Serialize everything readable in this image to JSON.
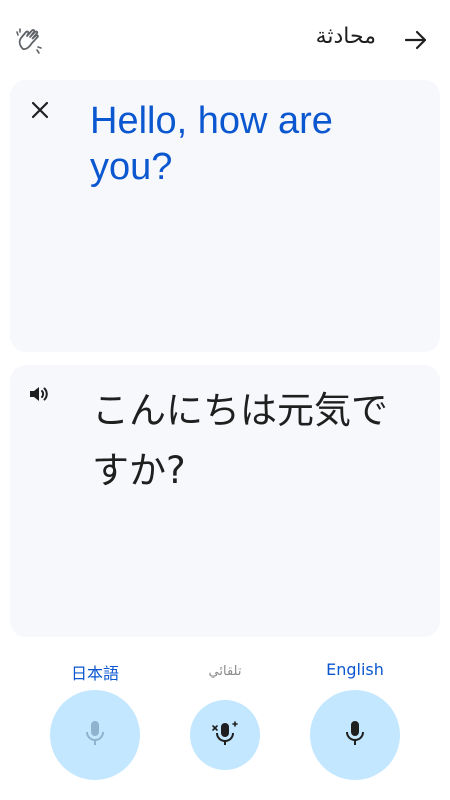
{
  "header": {
    "title": "محادثة",
    "icons": {
      "left": "hand-wave-icon",
      "right": "arrow-right-icon"
    }
  },
  "source_panel": {
    "text": "Hello, how are you?",
    "close_icon": "close-icon",
    "text_color": "#0b57d0"
  },
  "target_panel": {
    "text": "こんにちは元気ですか?",
    "speaker_icon": "speaker-icon"
  },
  "bottom": {
    "left_language": "日本語",
    "auto_label": "تلقائي",
    "right_language": "English",
    "mic_icon": "mic-icon",
    "auto_mic_icon": "auto-mic-icon",
    "accent": "#0b57d0",
    "mic_bg": "#c2e7ff"
  }
}
